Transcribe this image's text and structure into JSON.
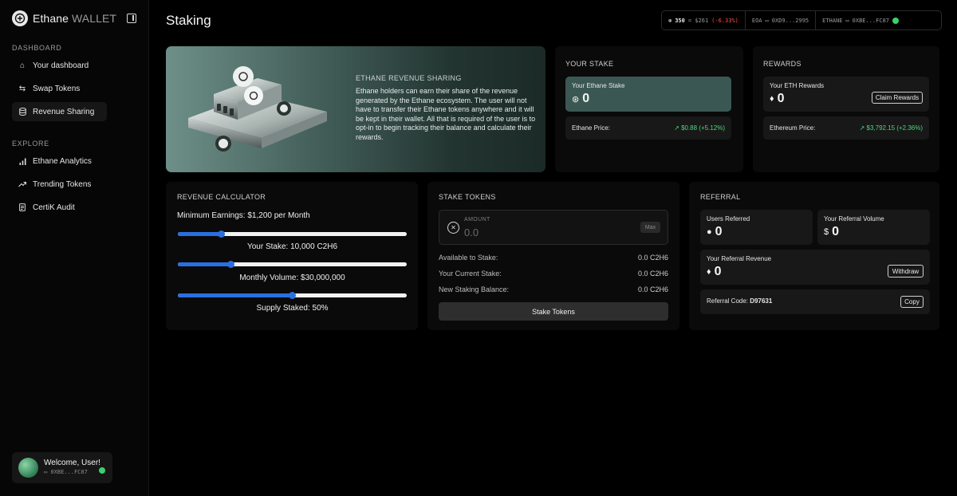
{
  "app": {
    "name": "Ethane",
    "name_suffix": "WALLET"
  },
  "sidebar": {
    "dashboard_label": "DASHBOARD",
    "explore_label": "EXPLORE",
    "dashboard_items": [
      {
        "label": "Your dashboard",
        "icon": "home-icon"
      },
      {
        "label": "Swap Tokens",
        "icon": "swap-icon"
      },
      {
        "label": "Revenue Sharing",
        "icon": "database-icon",
        "active": true
      }
    ],
    "explore_items": [
      {
        "label": "Ethane Analytics",
        "icon": "bar-chart-icon"
      },
      {
        "label": "Trending Tokens",
        "icon": "trending-up-icon"
      },
      {
        "label": "CertiK Audit",
        "icon": "document-icon"
      }
    ],
    "user": {
      "welcome": "Welcome, User!",
      "address": "0XBE...FC87"
    }
  },
  "header": {
    "title": "Staking",
    "price_count": "350",
    "price_value": "= $261",
    "price_change": "(-6.33%)",
    "eoa_label": "EOA",
    "eoa_address": "0XD9...2995",
    "ethane_label": "ETHANE",
    "ethane_address": "0XBE...FC87"
  },
  "hero": {
    "title": "ETHANE REVENUE SHARING",
    "text": "Ethane holders can earn their share of the revenue generated by the Ethane ecosystem. The user will not have to transfer their Ethane tokens anywhere and it will be kept in their wallet. All that is required of the user is to opt-in to begin tracking their balance and calculate their rewards."
  },
  "your_stake": {
    "title": "YOUR STAKE",
    "label": "Your Ethane Stake",
    "value": "0",
    "price_label": "Ethane Price:",
    "price_value": "$0.88 (+5.12%)"
  },
  "rewards": {
    "title": "REWARDS",
    "label": "Your ETH Rewards",
    "value": "0",
    "claim_label": "Claim Rewards",
    "price_label": "Ethereum Price:",
    "price_value": "$3,792.15 (+2.36%)"
  },
  "calculator": {
    "title": "REVENUE CALCULATOR",
    "min_earnings": "Minimum Earnings: $1,200 per Month",
    "sliders": [
      {
        "caption": "Your Stake: 10,000 C2H6",
        "level": 0.19
      },
      {
        "caption": "Monthly Volume: $30,000,000",
        "level": 0.23
      },
      {
        "caption": "Supply Staked: 50%",
        "level": 0.5
      }
    ]
  },
  "stake_tokens": {
    "title": "STAKE TOKENS",
    "amount_label": "AMOUNT",
    "amount_placeholder": "0.0",
    "max_label": "Max",
    "rows": [
      {
        "label": "Available to Stake:",
        "value": "0.0 C2H6"
      },
      {
        "label": "Your Current Stake:",
        "value": "0.0 C2H6"
      },
      {
        "label": "New Staking Balance:",
        "value": "0.0 C2H6"
      }
    ],
    "button_label": "Stake Tokens"
  },
  "referral": {
    "title": "REFERRAL",
    "users_label": "Users Referred",
    "users_value": "0",
    "volume_label": "Your Referral Volume",
    "volume_value": "0",
    "revenue_label": "Your Referral Revenue",
    "revenue_value": "0",
    "withdraw_label": "Withdraw",
    "code_label": "Referral Code:",
    "code_value": "D97631",
    "copy_label": "Copy"
  },
  "colors": {
    "accent_blue": "#2a6fe0",
    "positive": "#4cd87d",
    "negative": "#ff4d4d",
    "teal": "#3b5753"
  }
}
